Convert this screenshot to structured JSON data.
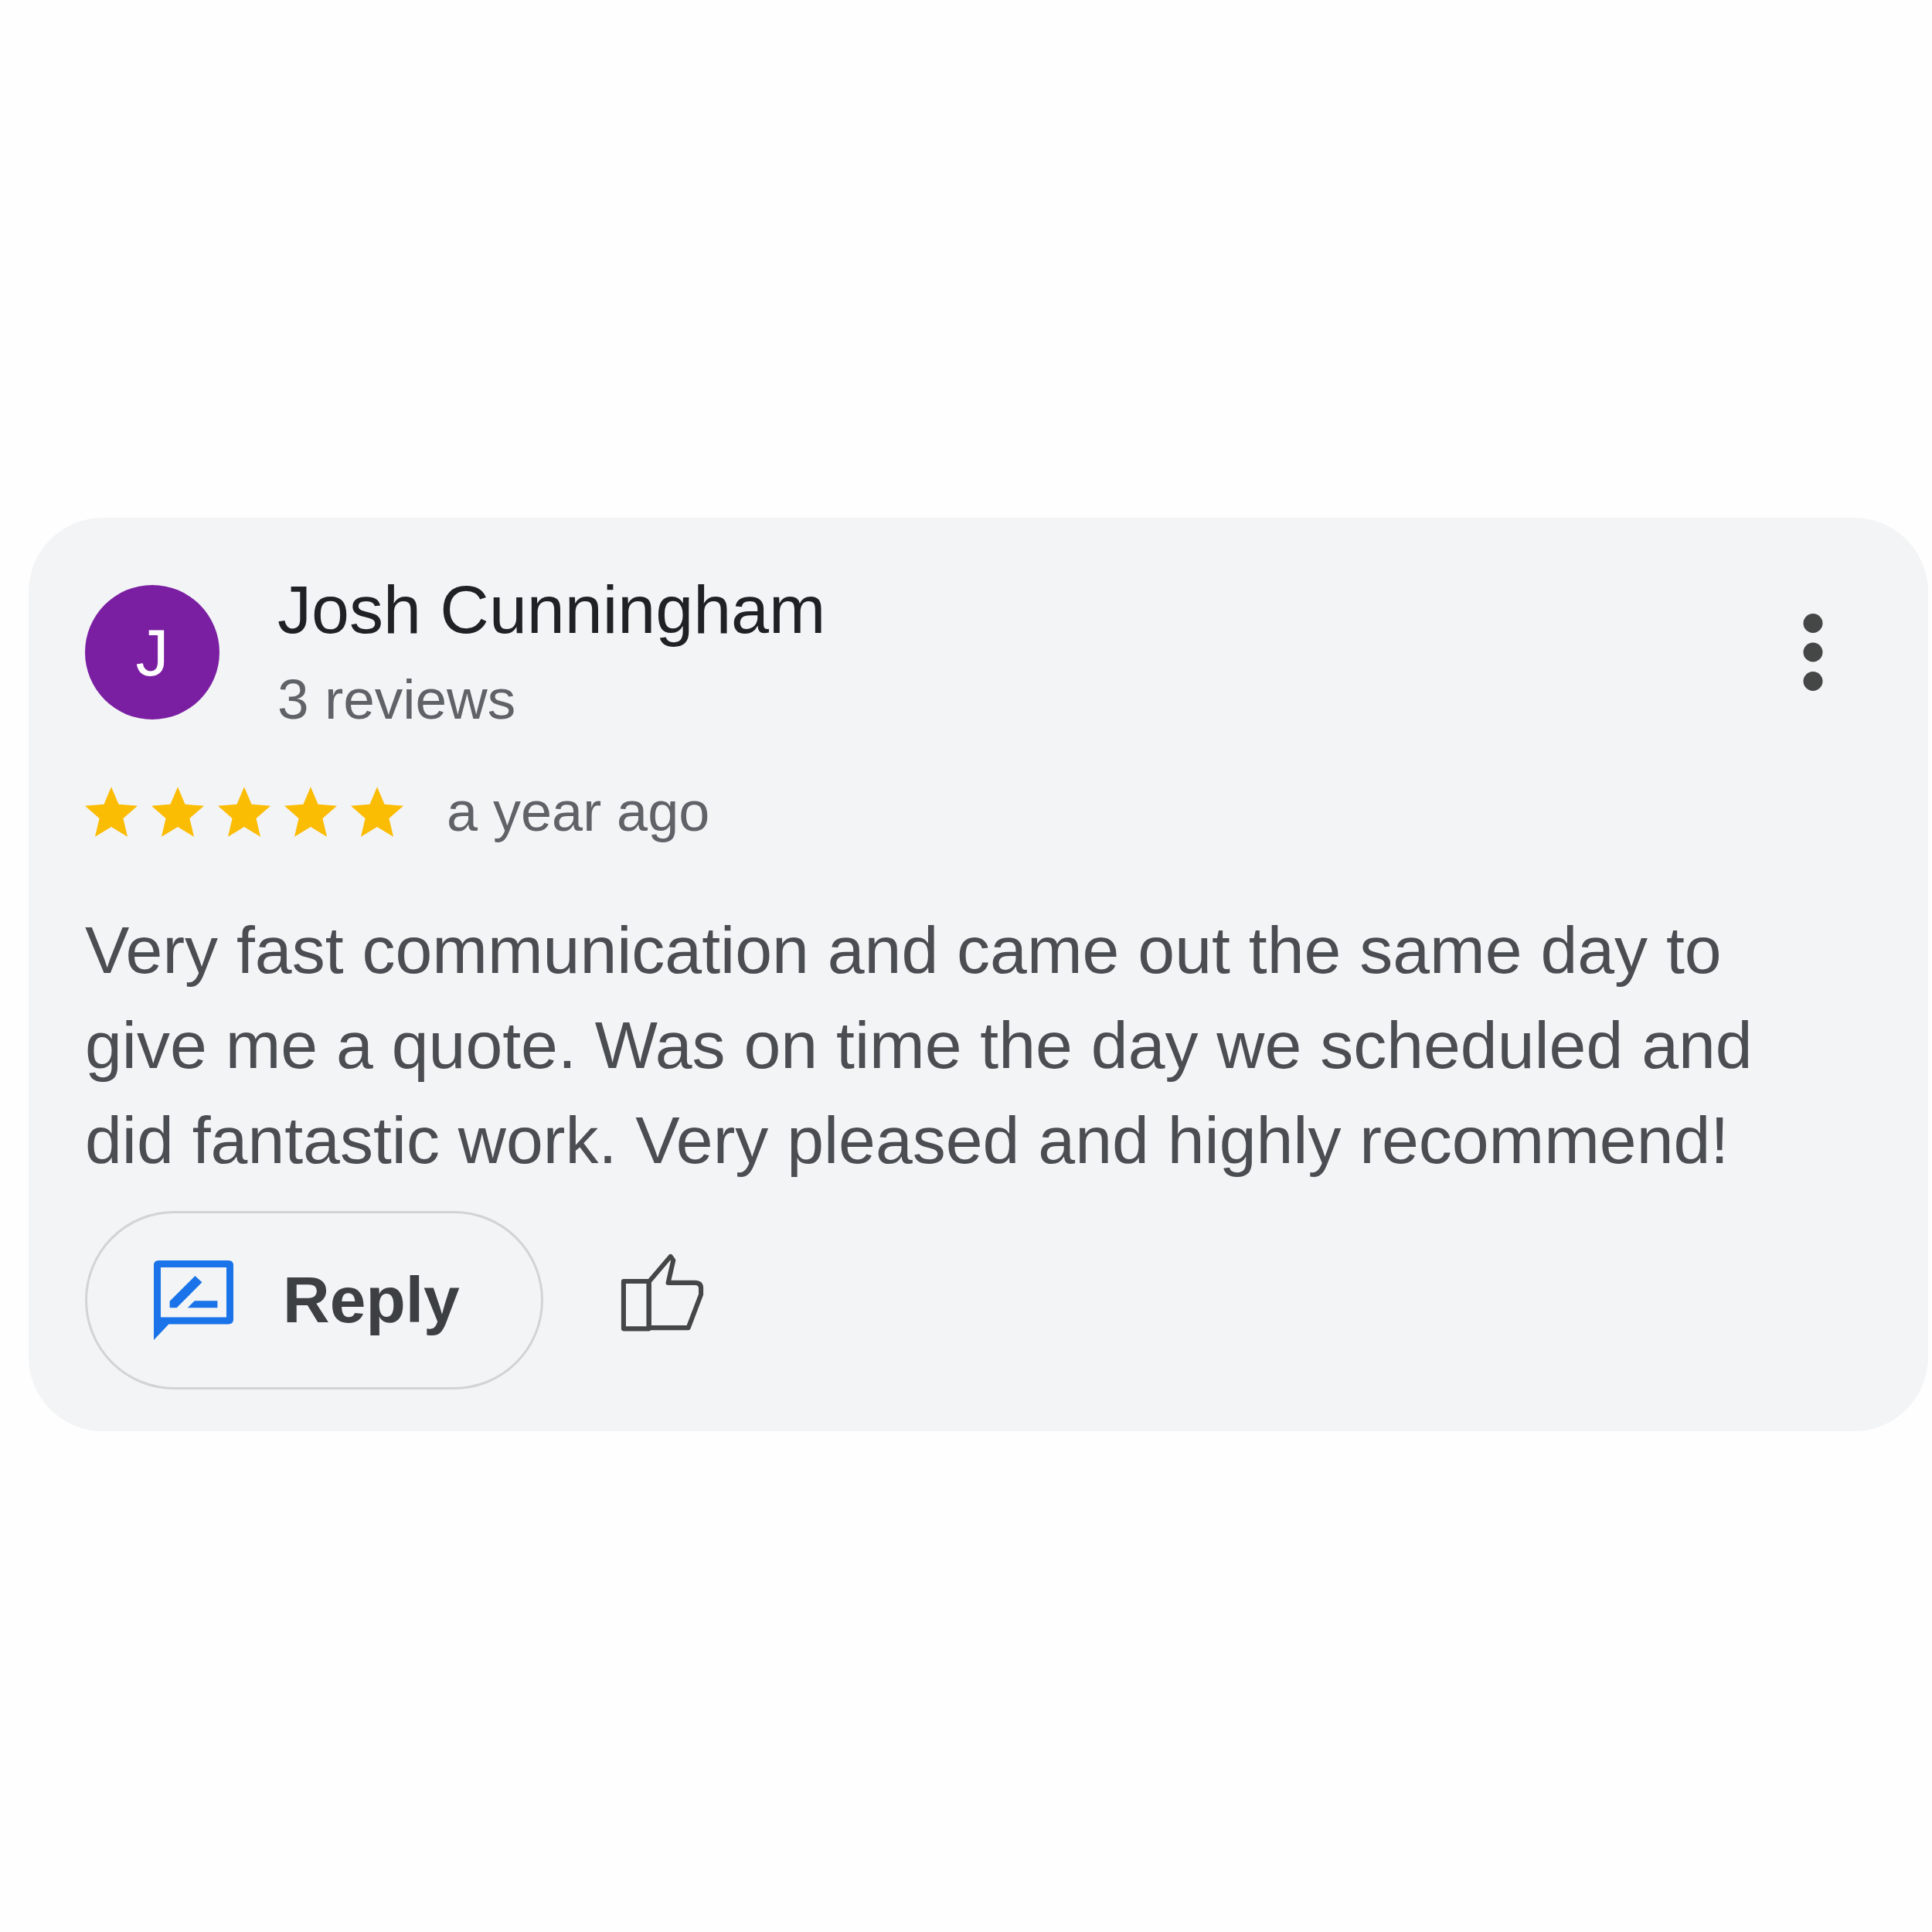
{
  "review": {
    "avatar_initial": "J",
    "author": "Josh Cunningham",
    "review_count": "3 reviews",
    "stars": 5,
    "time": "a year ago",
    "text": "Very fast communication and came out the same day to give me a quote. Was on time the day we scheduled and did fantastic work. Very pleased and highly recommend!",
    "reply_button": "Reply"
  }
}
